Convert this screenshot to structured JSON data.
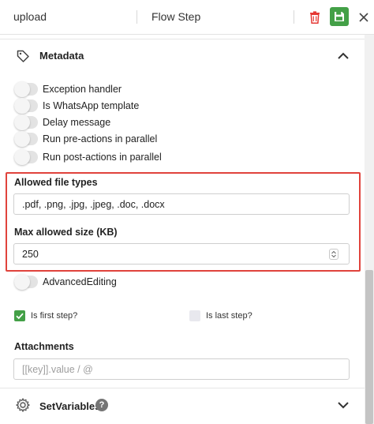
{
  "header": {
    "step_name": "upload",
    "step_type": "Flow Step"
  },
  "metadata": {
    "title": "Metadata",
    "toggles": [
      {
        "label": "Exception handler",
        "on": false
      },
      {
        "label": "Is WhatsApp template",
        "on": false
      },
      {
        "label": "Delay message",
        "on": false
      },
      {
        "label": "Run pre-actions in parallel",
        "on": false
      },
      {
        "label": "Run post-actions in parallel",
        "on": false
      }
    ]
  },
  "allowed_file_types": {
    "label": "Allowed file types",
    "value": ".pdf, .png, .jpg, .jpeg, .doc, .docx"
  },
  "max_size": {
    "label": "Max allowed size (KB)",
    "value": "250"
  },
  "advanced_editing": {
    "label": "AdvancedEditing",
    "on": false
  },
  "first_step": {
    "label": "Is first step?",
    "checked": true
  },
  "last_step": {
    "label": "Is last step?",
    "checked": false
  },
  "attachments": {
    "label": "Attachments",
    "placeholder": "[[key]].value / @"
  },
  "set_variables": {
    "title": "SetVariables",
    "help": "?"
  },
  "colors": {
    "accent_green": "#43a047",
    "highlight_red": "#e0433c",
    "delete_red": "#e53935"
  }
}
